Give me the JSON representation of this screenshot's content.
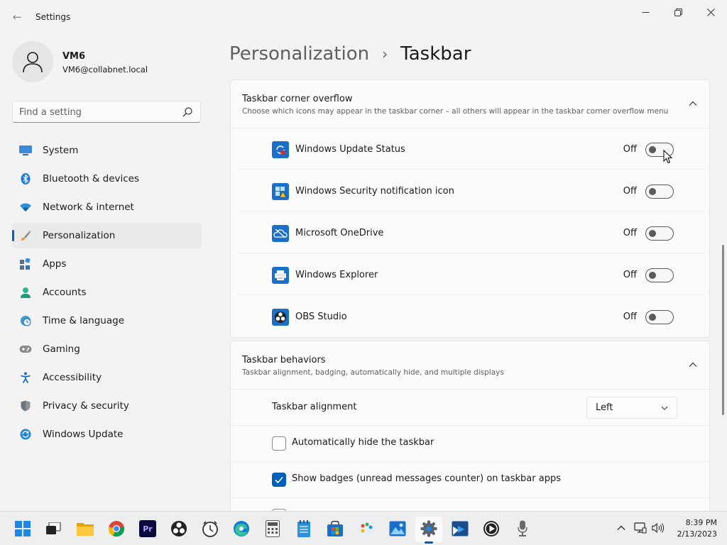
{
  "window": {
    "title": "Settings",
    "back_glyph": "←"
  },
  "user": {
    "name": "VM6",
    "email": "VM6@collabnet.local"
  },
  "search": {
    "placeholder": "Find a setting"
  },
  "nav": {
    "items": [
      {
        "label": "System",
        "icon": "system-icon"
      },
      {
        "label": "Bluetooth & devices",
        "icon": "bluetooth-icon"
      },
      {
        "label": "Network & internet",
        "icon": "wifi-icon"
      },
      {
        "label": "Personalization",
        "icon": "brush-icon",
        "active": true
      },
      {
        "label": "Apps",
        "icon": "apps-icon"
      },
      {
        "label": "Accounts",
        "icon": "accounts-icon"
      },
      {
        "label": "Time & language",
        "icon": "globe-clock-icon"
      },
      {
        "label": "Gaming",
        "icon": "gamepad-icon"
      },
      {
        "label": "Accessibility",
        "icon": "accessibility-icon"
      },
      {
        "label": "Privacy & security",
        "icon": "shield-icon"
      },
      {
        "label": "Windows Update",
        "icon": "update-icon"
      }
    ]
  },
  "header": {
    "parent": "Personalization",
    "separator": "›",
    "current": "Taskbar"
  },
  "overflow": {
    "title": "Taskbar corner overflow",
    "subtitle": "Choose which icons may appear in the taskbar corner – all others will appear in the taskbar corner overflow menu",
    "items": [
      {
        "label": "Windows Update Status",
        "state": "Off",
        "on": false,
        "icon": "windows-update-status-icon"
      },
      {
        "label": "Windows Security notification icon",
        "state": "Off",
        "on": false,
        "icon": "windows-security-icon"
      },
      {
        "label": "Microsoft OneDrive",
        "state": "Off",
        "on": false,
        "icon": "onedrive-icon"
      },
      {
        "label": "Windows Explorer",
        "state": "Off",
        "on": false,
        "icon": "windows-explorer-icon"
      },
      {
        "label": "OBS Studio",
        "state": "Off",
        "on": false,
        "icon": "obs-studio-icon"
      }
    ]
  },
  "behaviors": {
    "title": "Taskbar behaviors",
    "subtitle": "Taskbar alignment, badging, automatically hide, and multiple displays",
    "alignment_label": "Taskbar alignment",
    "alignment_value": "Left",
    "auto_hide_label": "Automatically hide the taskbar",
    "auto_hide_checked": false,
    "badges_label": "Show badges (unread messages counter) on taskbar apps",
    "badges_checked": true
  },
  "taskbar": {
    "icons": [
      "start-icon",
      "task-view-icon",
      "file-explorer-icon",
      "chrome-icon",
      "premiere-pro-icon",
      "obs-icon",
      "clock-app-icon",
      "edge-icon",
      "calculator-icon",
      "notepad-icon",
      "store-icon",
      "paint-icon",
      "photos-icon",
      "settings-icon",
      "media-player-icon",
      "video-player-icon",
      "microphone-icon"
    ],
    "premiere_label": "Pr",
    "time": "8:39 PM",
    "date": "2/13/2023"
  },
  "colors": {
    "accent": "#005fb8",
    "background": "#f3f3f3",
    "card": "#fbfbfb"
  }
}
